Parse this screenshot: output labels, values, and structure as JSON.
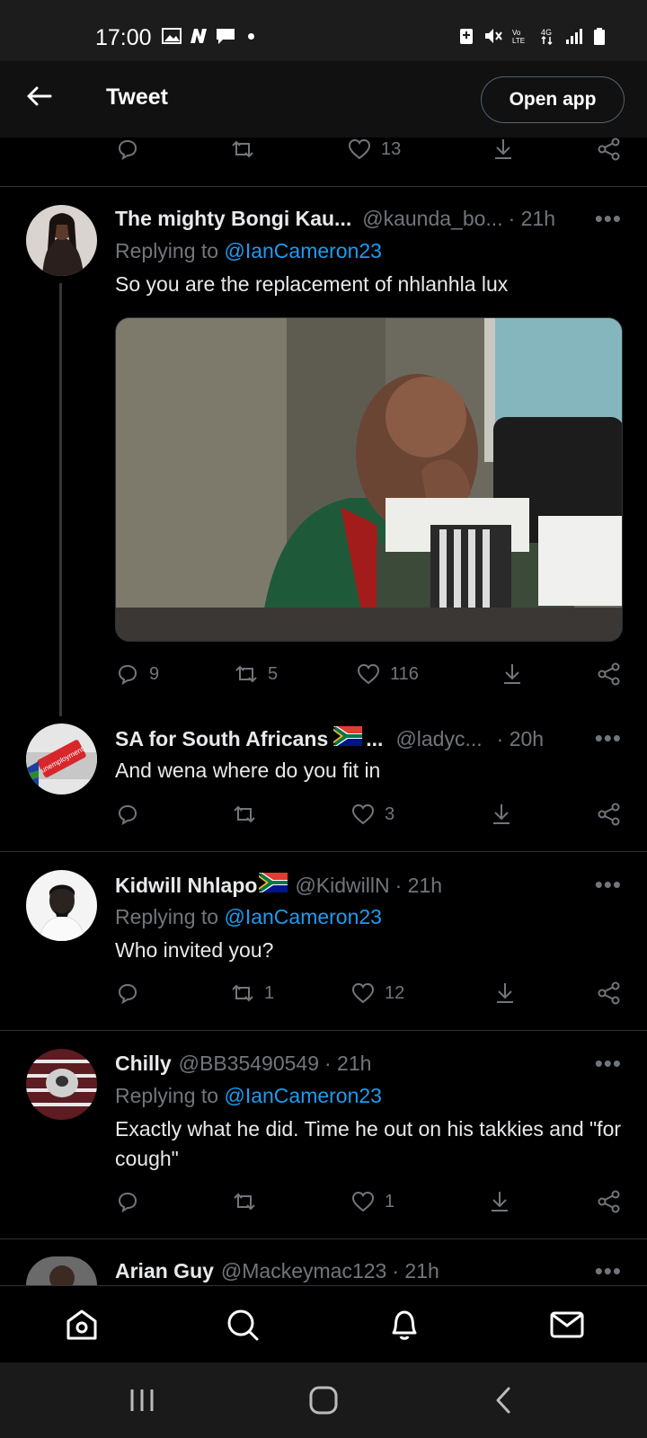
{
  "status_bar": {
    "time": "17:00",
    "left_icons": [
      "gallery-icon",
      "n-app-icon",
      "message-icon",
      "dot"
    ],
    "right_icons": [
      "battery-saver-icon",
      "mute-icon",
      "volte-icon",
      "4g-icon",
      "signal-icon",
      "battery-icon"
    ]
  },
  "header": {
    "title": "Tweet",
    "open_app": "Open app"
  },
  "top_actions": {
    "reply": "",
    "retweet": "",
    "like": "13"
  },
  "tweets": [
    {
      "name": "The mighty Bongi Kau...",
      "handle": "@kaunda_bo...",
      "time": "· 21h",
      "replying_prefix": "Replying to ",
      "replying_to": "@IanCameron23",
      "text": "So you are the replacement of nhlanhla lux",
      "replies": "9",
      "retweets": "5",
      "likes": "116"
    },
    {
      "name": "SA for South Africans",
      "name_suffix": "...",
      "handle": "@ladyc...",
      "time": "· 20h",
      "text": "And wena where do you fit in",
      "replies": "",
      "retweets": "",
      "likes": "3",
      "avatar_text": "unemployment"
    },
    {
      "name": "Kidwill Nhlapo",
      "handle": "@KidwillN",
      "time": "· 21h",
      "replying_prefix": "Replying to ",
      "replying_to": "@IanCameron23",
      "text": "Who invited you?",
      "replies": "",
      "retweets": "1",
      "likes": "12"
    },
    {
      "name": "Chilly",
      "handle": "@BB35490549",
      "time": "· 21h",
      "replying_prefix": "Replying to ",
      "replying_to": "@IanCameron23",
      "text": "Exactly what he did. Time he out on his takkies and \"for cough\"",
      "replies": "",
      "retweets": "",
      "likes": "1"
    },
    {
      "name": "Arian Guy",
      "handle": "@Mackeymac123",
      "time": "· 21h"
    }
  ],
  "more": "•••",
  "colors": {
    "accent": "#1d9bf0",
    "muted": "#71767b",
    "background": "#000000"
  }
}
